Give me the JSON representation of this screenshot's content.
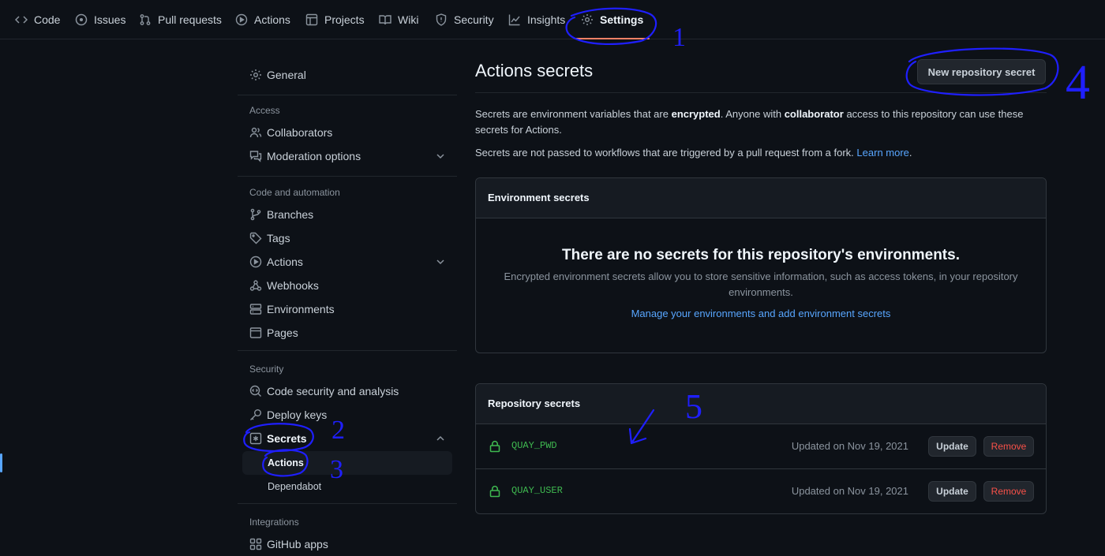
{
  "repo_nav": {
    "tabs": [
      {
        "label": "Code",
        "icon": "code-icon"
      },
      {
        "label": "Issues",
        "icon": "issue-opened-icon"
      },
      {
        "label": "Pull requests",
        "icon": "git-pull-request-icon"
      },
      {
        "label": "Actions",
        "icon": "play-icon"
      },
      {
        "label": "Projects",
        "icon": "table-icon"
      },
      {
        "label": "Wiki",
        "icon": "book-icon"
      },
      {
        "label": "Security",
        "icon": "shield-icon"
      },
      {
        "label": "Insights",
        "icon": "graph-icon"
      },
      {
        "label": "Settings",
        "icon": "gear-icon",
        "selected": true
      }
    ]
  },
  "sidebar": {
    "general": "General",
    "access_heading": "Access",
    "collaborators": "Collaborators",
    "moderation": "Moderation options",
    "code_automation_heading": "Code and automation",
    "branches": "Branches",
    "tags": "Tags",
    "actions": "Actions",
    "webhooks": "Webhooks",
    "environments": "Environments",
    "pages": "Pages",
    "security_heading": "Security",
    "code_security": "Code security and analysis",
    "deploy_keys": "Deploy keys",
    "secrets": "Secrets",
    "secrets_actions": "Actions",
    "secrets_dependabot": "Dependabot",
    "integrations_heading": "Integrations",
    "github_apps": "GitHub apps"
  },
  "main": {
    "title": "Actions secrets",
    "new_secret_button": "New repository secret",
    "intro_1": "Secrets are environment variables that are",
    "intro_encrypted": "encrypted",
    "intro_2": ". Anyone with",
    "intro_collaborator": "collaborator",
    "intro_3": "access to this repository can use these secrets for Actions.",
    "intro_fork": "Secrets are not passed to workflows that are triggered by a pull request from a fork.",
    "learn_more": "Learn more",
    "env_box": {
      "heading": "Environment secrets",
      "blank_title": "There are no secrets for this repository's environments.",
      "blank_text": "Encrypted environment secrets allow you to store sensitive information, such as access tokens, in your repository environments.",
      "link": "Manage your environments and add environment secrets"
    },
    "repo_box": {
      "heading": "Repository secrets",
      "secrets": [
        {
          "name": "QUAY_PWD",
          "updated": "Updated on Nov 19, 2021"
        },
        {
          "name": "QUAY_USER",
          "updated": "Updated on Nov 19, 2021"
        }
      ],
      "update_label": "Update",
      "remove_label": "Remove"
    }
  },
  "annotations": {
    "color": "#1f1fff",
    "labels": [
      "1",
      "2",
      "3",
      "4",
      "5"
    ]
  }
}
